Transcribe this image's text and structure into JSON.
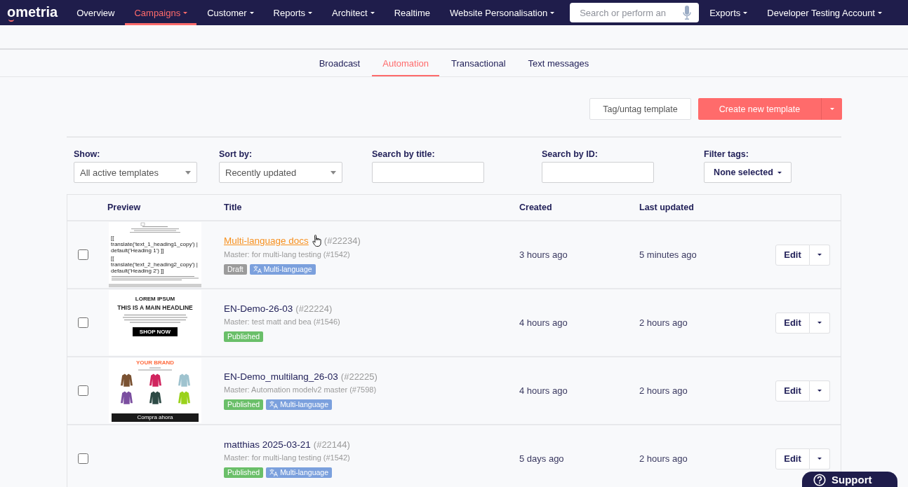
{
  "nav": {
    "logo": "ometria",
    "items": [
      {
        "label": "Overview",
        "dropdown": false,
        "selected": false
      },
      {
        "label": "Campaigns",
        "dropdown": true,
        "selected": true
      },
      {
        "label": "Customer",
        "dropdown": true,
        "selected": false
      },
      {
        "label": "Reports",
        "dropdown": true,
        "selected": false
      },
      {
        "label": "Architect",
        "dropdown": true,
        "selected": false
      },
      {
        "label": "Realtime",
        "dropdown": false,
        "selected": false
      },
      {
        "label": "Website Personalisation",
        "dropdown": true,
        "selected": false
      }
    ],
    "search": {
      "placeholder": "Search or perform an"
    },
    "right_items": [
      {
        "label": "Exports",
        "dropdown": true,
        "selected": false
      },
      {
        "label": "Developer Testing Account",
        "dropdown": true,
        "selected": false
      }
    ]
  },
  "tabs": [
    {
      "label": "Broadcast",
      "selected": false
    },
    {
      "label": "Automation",
      "selected": true
    },
    {
      "label": "Transactional",
      "selected": false
    },
    {
      "label": "Text messages",
      "selected": false
    }
  ],
  "actions": {
    "tag_button": "Tag/untag template",
    "create_button": "Create new template"
  },
  "filters": [
    {
      "label": "Show:",
      "kind": "select",
      "value": "All active templates"
    },
    {
      "label": "Sort by:",
      "kind": "select",
      "value": "Recently updated"
    },
    {
      "label": "Search by title:",
      "kind": "input"
    },
    {
      "label": "Search by ID:",
      "kind": "input"
    },
    {
      "label": "Filter tags:",
      "kind": "dropdown",
      "value": "None selected"
    }
  ],
  "table": {
    "columns": [
      "Preview",
      "Title",
      "Created",
      "Last updated"
    ],
    "rows": [
      {
        "checked": false,
        "title": "Multi-language docs",
        "hovered": true,
        "id": "(#22234)",
        "master": "Master: for multi-lang testing (#1542)",
        "tags": [
          {
            "label": "Draft",
            "kind": "status",
            "color": "#9b9b9b"
          },
          {
            "label": "Multi-language",
            "kind": "language",
            "color": "#7ba0dd"
          }
        ],
        "created": "3 hours ago",
        "updated": "5 minutes ago",
        "action": "Edit",
        "preview": {
          "kind": "code",
          "lines": [
            "[[ translate('text_1_heading1_copy') | default('Heading 1') ]]",
            "[[ translate('text_2_heading2_copy') | default('Heading 2') ]]"
          ]
        }
      },
      {
        "checked": false,
        "title": "EN-Demo-26-03",
        "hovered": false,
        "id": "(#22224)",
        "master": "Master: test matt and bea (#1546)",
        "tags": [
          {
            "label": "Published",
            "kind": "status",
            "color": "#6abf69"
          }
        ],
        "created": "4 hours ago",
        "updated": "2 hours ago",
        "action": "Edit",
        "preview": {
          "kind": "headline",
          "kicker": "LOREM IPSUM",
          "headline": "THIS IS A MAIN HEADLINE",
          "button": "SHOP NOW"
        }
      },
      {
        "checked": false,
        "title": "EN-Demo_multilang_26-03",
        "hovered": false,
        "id": "(#22225)",
        "master": "Master: Automation modelv2 master (#7598)",
        "tags": [
          {
            "label": "Published",
            "kind": "status",
            "color": "#6abf69"
          },
          {
            "label": "Multi-language",
            "kind": "language",
            "color": "#7ba0dd"
          }
        ],
        "created": "4 hours ago",
        "updated": "2 hours ago",
        "action": "Edit",
        "preview": {
          "kind": "products",
          "brand": "YOUR BRAND",
          "button": "Compra ahora"
        }
      },
      {
        "checked": false,
        "title": "matthias 2025-03-21",
        "hovered": false,
        "id": "(#22144)",
        "master": "Master: for multi-lang testing (#1542)",
        "tags": [
          {
            "label": "Published",
            "kind": "status",
            "color": "#6abf69"
          },
          {
            "label": "Multi-language",
            "kind": "language",
            "color": "#7ba0dd"
          }
        ],
        "created": "5 days ago",
        "updated": "2 hours ago",
        "action": "Edit"
      }
    ]
  },
  "support_button": "Support"
}
